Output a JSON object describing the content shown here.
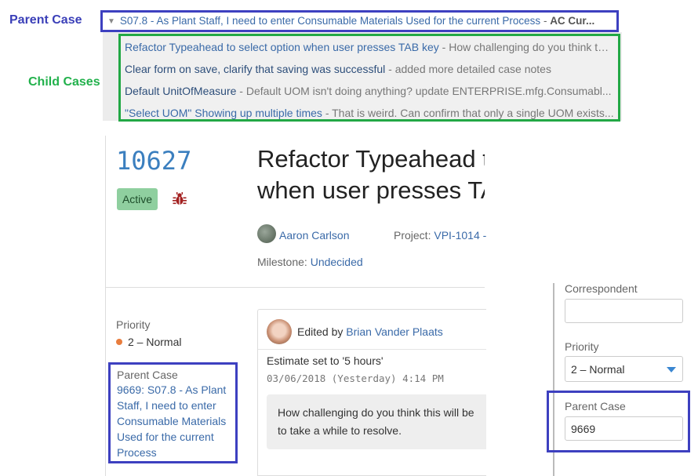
{
  "annotations": {
    "parent_case_label": "Parent Case",
    "child_cases_label": "Child Cases"
  },
  "parent_bar": {
    "title": "S07.8 - As Plant Staff, I need to enter Consumable Materials Used for the current Process",
    "separator": " - ",
    "project": "AC Cur..."
  },
  "child_cases": [
    {
      "title": "Refactor Typeahead to select option when user presses TAB key",
      "note": " - How challenging do you think thi..."
    },
    {
      "title": "Clear form on save, clarify that saving was successful",
      "note": " - added more detailed case notes"
    },
    {
      "title": "Default UnitOfMeasure",
      "note": " - Default UOM isn't doing anything? update ENTERPRISE.mfg.Consumabl..."
    },
    {
      "title": "\"Select UOM\" Showing up multiple times",
      "note": " - That is weird. Can confirm that only a single UOM exists..."
    }
  ],
  "case": {
    "number": "10627",
    "status": "Active",
    "title": "Refactor Typeahead to select option when user presses TAB key",
    "owner": "Aaron Carlson",
    "project_label": "Project: ",
    "project_value": "VPI-1014 -",
    "milestone_label": "Milestone: ",
    "milestone_value": "Undecided"
  },
  "left_fields": {
    "priority_label": "Priority",
    "priority_value": "2 – Normal",
    "parent_case_label": "Parent Case",
    "parent_case_lines": [
      "9669: S07.8 - As Plant",
      "Staff, I need to enter",
      "Consumable Materials",
      "Used for the current",
      "Process"
    ]
  },
  "event": {
    "edited_by_prefix": "Edited by ",
    "edited_by_user": "Brian Vander Plaats",
    "change_text": "Estimate set to '5 hours'",
    "date": "03/06/2018 (Yesterday) 4:14 PM",
    "note_lines": [
      "How challenging do you think this will be",
      "to take a while to resolve."
    ]
  },
  "right_panel": {
    "correspondent_label": "Correspondent",
    "correspondent_value": "",
    "priority_label": "Priority",
    "priority_value": "2 – Normal",
    "parent_case_label": "Parent Case",
    "parent_case_value": "9669"
  },
  "colors": {
    "annotation_blue": "#3d40c0",
    "annotation_green": "#22a845",
    "link": "#3a6aa8",
    "status_active": "#8fcf9f",
    "priority_dot": "#e87d3e",
    "bug": "#a32020"
  },
  "icons": {
    "collapse": "caret-down-icon",
    "bug": "bug-icon",
    "select_arrow": "chevron-down-icon"
  }
}
